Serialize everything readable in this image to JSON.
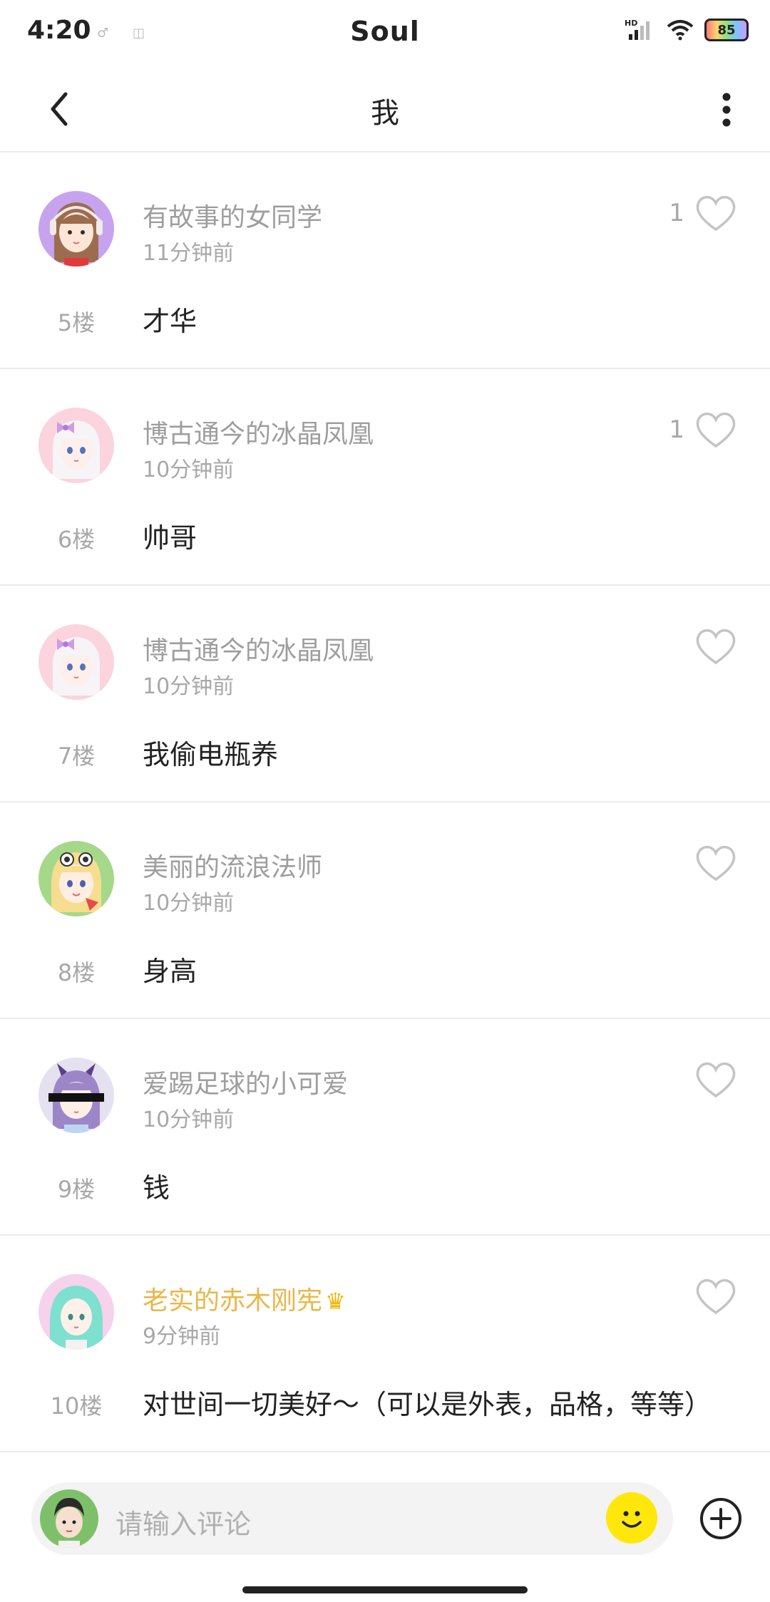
{
  "status_bar": {
    "time": "4:20",
    "app_name": "Soul",
    "signal_label": "HD",
    "battery": "85"
  },
  "header": {
    "title": "我"
  },
  "comments": [
    {
      "username": "有故事的女同学",
      "time": "11分钟前",
      "likes": "1",
      "floor": "5楼",
      "content": "才华",
      "avatar": "girl-headphones"
    },
    {
      "username": "博古通今的冰晶凤凰",
      "time": "10分钟前",
      "likes": "1",
      "floor": "6楼",
      "content": "帅哥",
      "avatar": "girl-bow-white"
    },
    {
      "username": "博古通今的冰晶凤凰",
      "time": "10分钟前",
      "likes": "",
      "floor": "7楼",
      "content": "我偷电瓶养",
      "avatar": "girl-bow-white"
    },
    {
      "username": "美丽的流浪法师",
      "time": "10分钟前",
      "likes": "",
      "floor": "8楼",
      "content": "身高",
      "avatar": "girl-blonde-sunglasses"
    },
    {
      "username": "爱踢足球的小可爱",
      "time": "10分钟前",
      "likes": "",
      "floor": "9楼",
      "content": "钱",
      "avatar": "girl-horns-censored"
    },
    {
      "username": "老实的赤木刚宪",
      "time": "9分钟前",
      "likes": "",
      "floor": "10楼",
      "content": "对世间一切美好～（可以是外表，品格，等等）",
      "avatar": "girl-teal-hair",
      "vip": true
    }
  ],
  "input": {
    "placeholder": "请输入评论"
  },
  "colors": {
    "vip_name": "#e7b84a",
    "muted": "#a8a8a8",
    "emoji_bg": "#ffe70b"
  }
}
